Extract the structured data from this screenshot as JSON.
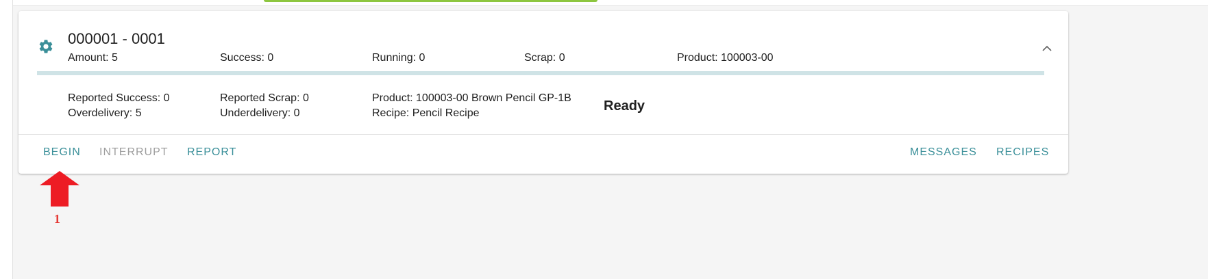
{
  "order": {
    "title": "000001 - 0001",
    "stats": {
      "amount": "Amount: 5",
      "success": "Success: 0",
      "running": "Running: 0",
      "scrap": "Scrap: 0",
      "product": "Product: 100003-00"
    },
    "progress_fraction": 0,
    "details": {
      "reported_success": "Reported Success: 0",
      "overdelivery": "Overdelivery: 5",
      "reported_scrap": "Reported Scrap: 0",
      "underdelivery": "Underdelivery: 0",
      "product_full": "Product: 100003-00 Brown Pencil GP-1B",
      "recipe": "Recipe: Pencil Recipe"
    },
    "status": "Ready"
  },
  "actions": {
    "begin": "BEGIN",
    "interrupt": "INTERRUPT",
    "report": "REPORT",
    "messages": "MESSAGES",
    "recipes": "RECIPES"
  },
  "annotation": {
    "step_number": "1",
    "color": "#ed1c24"
  },
  "icons": {
    "card": "gear-icon",
    "collapse": "chevron-up-icon",
    "annotation": "arrow-up-icon"
  },
  "colors": {
    "accent": "#3a8f99",
    "progress_track": "#cfe3e6",
    "disabled": "#9e9e9e",
    "top_tab": "#8dc63f"
  }
}
